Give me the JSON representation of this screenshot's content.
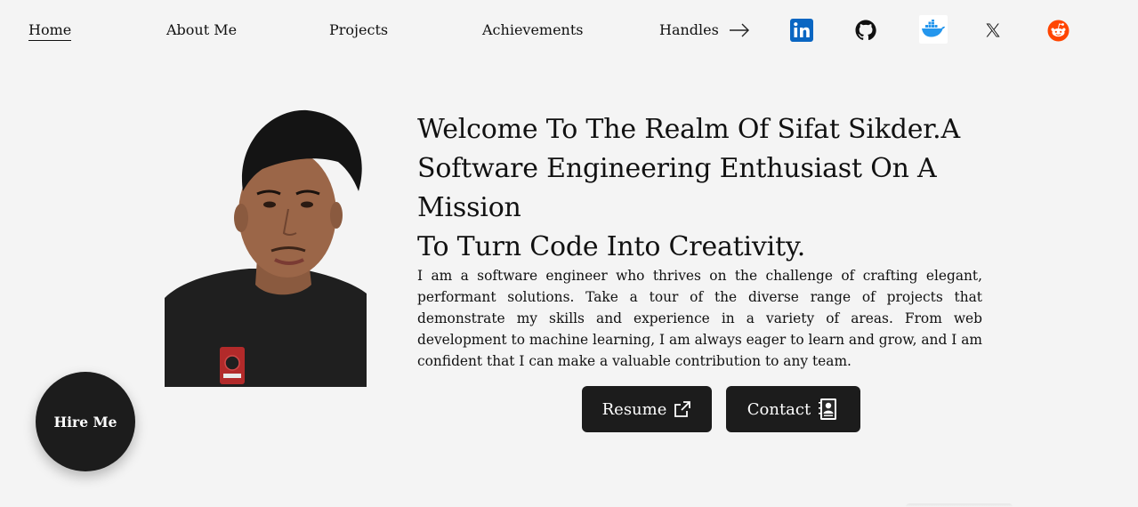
{
  "nav": {
    "items": [
      {
        "label": "Home",
        "active": true
      },
      {
        "label": "About Me"
      },
      {
        "label": "Projects"
      },
      {
        "label": "Achievements"
      },
      {
        "label": "Handles"
      }
    ],
    "arrow_icon": "arrow-right-icon",
    "socials": [
      {
        "icon": "linkedin-icon",
        "color": "#0a66c2"
      },
      {
        "icon": "github-icon",
        "color": "#111111"
      },
      {
        "icon": "docker-icon",
        "color": "#2496ed"
      },
      {
        "icon": "x-icon",
        "color": "#111111"
      },
      {
        "icon": "reddit-icon",
        "color": "#ff4500"
      }
    ]
  },
  "hero": {
    "headline_line1": "Welcome To The Realm Of Sifat Sikder.A",
    "headline_line2": "Software Engineering Enthusiast On A Mission",
    "headline_line3": "To Turn Code Into Creativity.",
    "bio": "I am a software engineer who thrives on the challenge of crafting elegant, performant solutions. Take a tour of the diverse range of projects that demonstrate my skills and experience in a variety of areas. From web development to machine learning, I am always eager to learn and grow, and I am confident that I can make a valuable contribution to any team."
  },
  "buttons": {
    "resume_label": "Resume",
    "resume_icon": "external-link-icon",
    "contact_label": "Contact",
    "contact_icon": "contact-book-icon"
  },
  "hire": {
    "label": "Hire Me"
  },
  "colors": {
    "background": "#f4f4f4",
    "button_bg": "#1c1c1c",
    "text": "#111111"
  }
}
